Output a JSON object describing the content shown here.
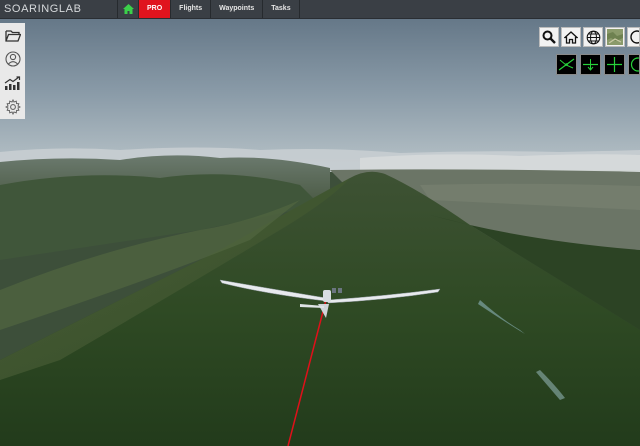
{
  "app": {
    "brand": "SOARINGLAB"
  },
  "nav": {
    "pro": "PRO",
    "flights": "Flights",
    "waypoints": "Waypoints",
    "tasks": "Tasks"
  },
  "left_tools": [
    "folder-icon",
    "user-circle-icon",
    "chart-trend-icon",
    "gear-icon"
  ],
  "right_tools": [
    "search-icon",
    "home-icon",
    "globe-icon",
    "map-layer-icon",
    "circle-icon"
  ],
  "view_tools": [
    "view-glider-icon",
    "view-down-icon",
    "view-cross-icon",
    "view-globe-icon"
  ],
  "colors": {
    "accent": "#e0141e",
    "topbar": "#3a3f45",
    "sky": "#93a5b2",
    "tow_line": "#e0101a",
    "view_green": "#27d33a"
  }
}
